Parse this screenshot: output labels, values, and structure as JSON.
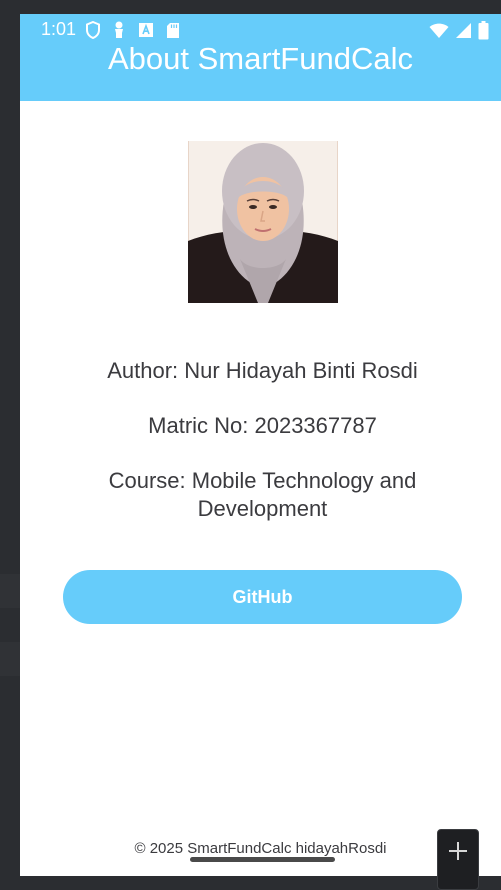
{
  "status_bar": {
    "time": "1:01"
  },
  "app_bar": {
    "title": "About SmartFundCalc"
  },
  "profile": {
    "photo_icon": "profile-photo"
  },
  "info": {
    "author": "Author: Nur Hidayah Binti Rosdi",
    "matric": "Matric No: 2023367787",
    "course": "Course: Mobile Technology and Development"
  },
  "actions": {
    "github_label": "GitHub"
  },
  "footer": {
    "text": "© 2025 SmartFundCalc hidayahRosdi"
  },
  "colors": {
    "accent": "#66ccfa",
    "text": "#3b3b3f",
    "background": "#ffffff"
  }
}
